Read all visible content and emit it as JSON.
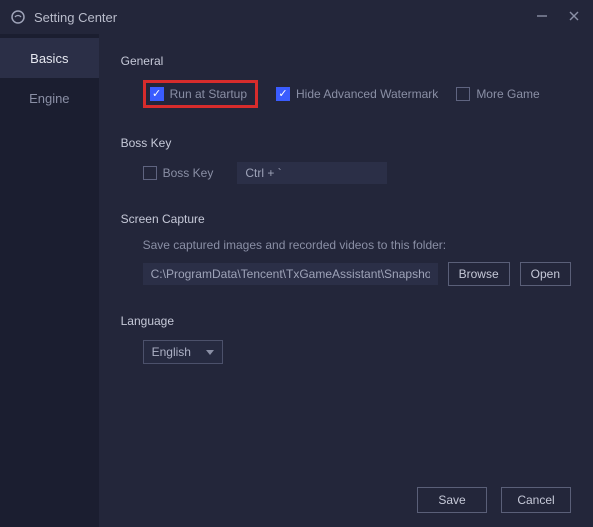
{
  "window": {
    "title": "Setting Center"
  },
  "sidebar": {
    "items": [
      {
        "label": "Basics"
      },
      {
        "label": "Engine"
      }
    ]
  },
  "sections": {
    "general": {
      "title": "General",
      "run_at_startup": "Run at Startup",
      "hide_watermark": "Hide Advanced Watermark",
      "more_game": "More Game"
    },
    "boss_key": {
      "title": "Boss Key",
      "label": "Boss Key",
      "hotkey": "Ctrl + `"
    },
    "screen_capture": {
      "title": "Screen Capture",
      "desc": "Save captured images and recorded videos to this folder:",
      "path": "C:\\ProgramData\\Tencent\\TxGameAssistant\\Snapshot",
      "browse": "Browse",
      "open": "Open"
    },
    "language": {
      "title": "Language",
      "selected": "English"
    }
  },
  "footer": {
    "save": "Save",
    "cancel": "Cancel"
  }
}
